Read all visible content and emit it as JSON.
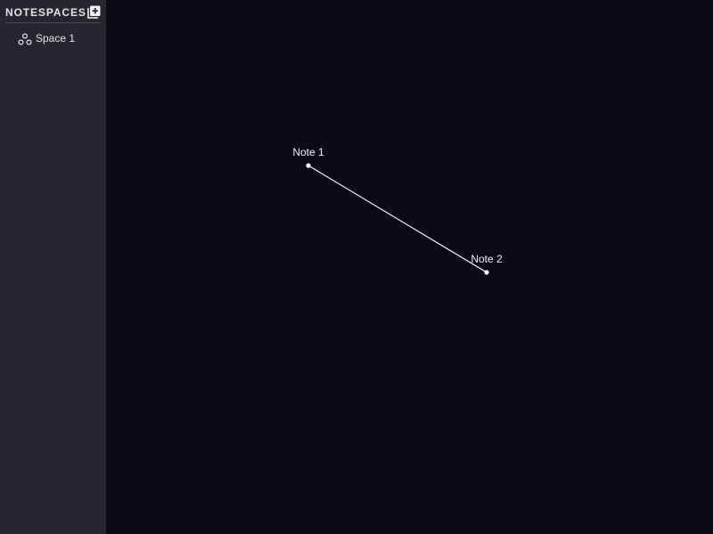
{
  "sidebar": {
    "title": "NOTESPACES",
    "add_icon": "add-box-icon",
    "items": [
      {
        "label": "Space 1",
        "icon": "graph-nodes-icon"
      }
    ]
  },
  "canvas": {
    "nodes": [
      {
        "label": "Note 1"
      },
      {
        "label": "Note 2"
      }
    ],
    "edges": [
      {
        "from": "Note 1",
        "to": "Note 2"
      }
    ]
  },
  "colors": {
    "sidebar_bg": "#26262f",
    "canvas_bg": "#0c0c17",
    "text": "#e4e4ea",
    "edge": "#ffffff"
  }
}
